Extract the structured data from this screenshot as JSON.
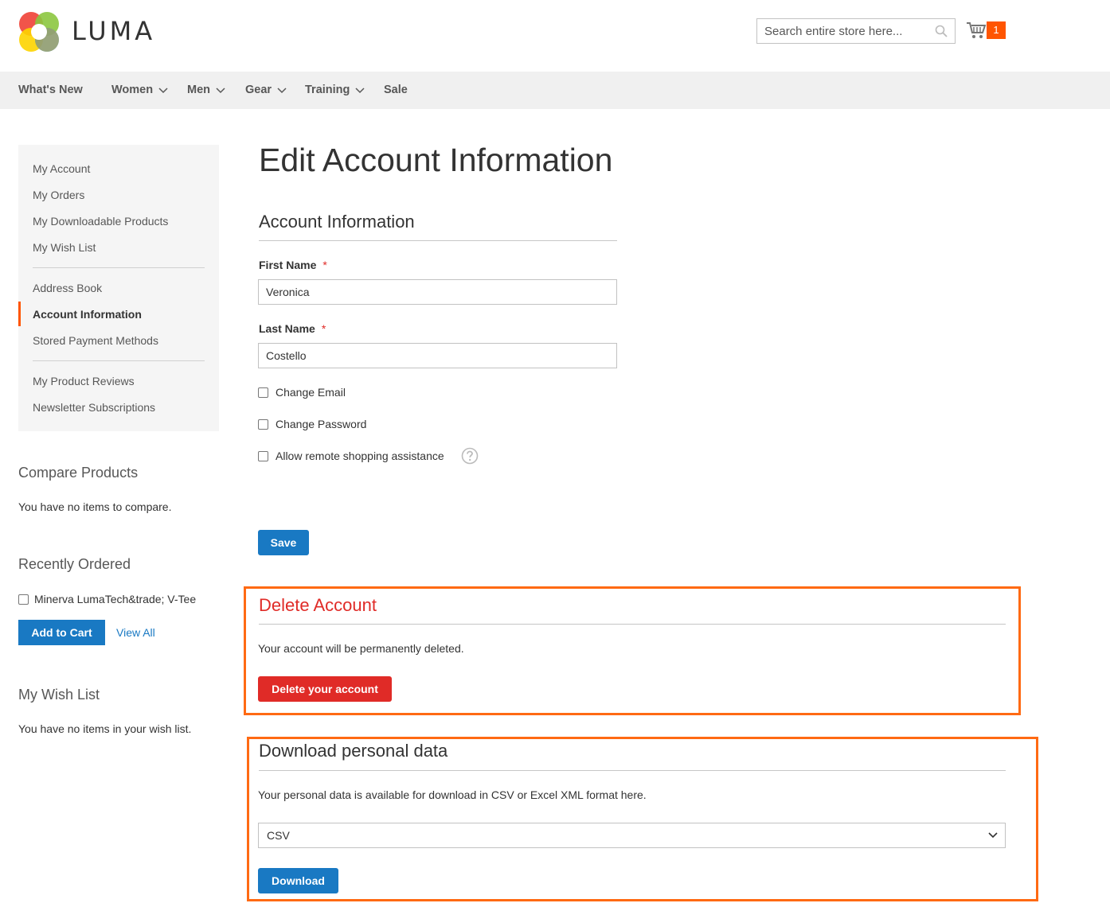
{
  "header": {
    "brand": "LUMA",
    "search_placeholder": "Search entire store here...",
    "cart_count": "1"
  },
  "nav": {
    "items": [
      {
        "label": "What's New",
        "has_dropdown": false
      },
      {
        "label": "Women",
        "has_dropdown": true
      },
      {
        "label": "Men",
        "has_dropdown": true
      },
      {
        "label": "Gear",
        "has_dropdown": true
      },
      {
        "label": "Training",
        "has_dropdown": true
      },
      {
        "label": "Sale",
        "has_dropdown": false
      }
    ]
  },
  "sidebar": {
    "items": [
      {
        "label": "My Account"
      },
      {
        "label": "My Orders"
      },
      {
        "label": "My Downloadable Products"
      },
      {
        "label": "My Wish List"
      },
      {
        "label": "Address Book"
      },
      {
        "label": "Account Information",
        "active": true
      },
      {
        "label": "Stored Payment Methods"
      },
      {
        "label": "My Product Reviews"
      },
      {
        "label": "Newsletter Subscriptions"
      }
    ],
    "compare": {
      "title": "Compare Products",
      "empty_text": "You have no items to compare."
    },
    "recently_ordered": {
      "title": "Recently Ordered",
      "item_label": "Minerva LumaTech&trade; V-Tee",
      "add_to_cart": "Add to Cart",
      "view_all": "View All"
    },
    "wishlist": {
      "title": "My Wish List",
      "empty_text": "You have no items in your wish list."
    }
  },
  "main": {
    "page_title": "Edit Account Information",
    "account_section_title": "Account Information",
    "first_name_label": "First Name",
    "first_name_value": "Veronica",
    "last_name_label": "Last Name",
    "last_name_value": "Costello",
    "required_mark": "*",
    "change_email": "Change Email",
    "change_password": "Change Password",
    "remote_assistance": "Allow remote shopping assistance",
    "save_label": "Save",
    "delete_section": {
      "title": "Delete Account",
      "text": "Your account will be permanently deleted.",
      "button": "Delete your account"
    },
    "download_section": {
      "title": "Download personal data",
      "text": "Your personal data is available for download in CSV or Excel XML format here.",
      "format_selected": "CSV",
      "button": "Download"
    }
  },
  "colors": {
    "accent": "#ff5501",
    "primary": "#1979c3",
    "danger": "#e02b27",
    "highlight_border": "#ff6a13"
  }
}
